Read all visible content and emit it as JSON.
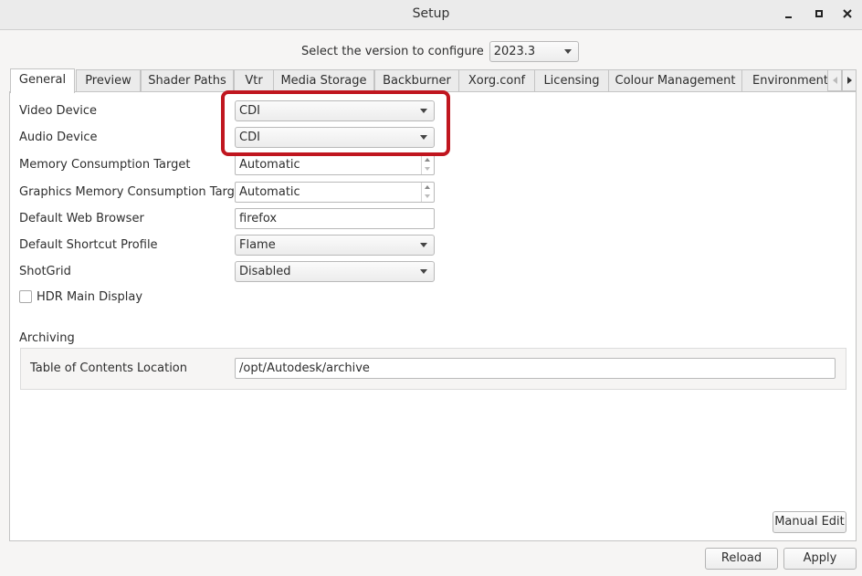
{
  "window": {
    "title": "Setup"
  },
  "version": {
    "label": "Select the version to configure",
    "value": "2023.3"
  },
  "tabs": [
    {
      "label": "General"
    },
    {
      "label": "Preview"
    },
    {
      "label": "Shader Paths"
    },
    {
      "label": "Vtr"
    },
    {
      "label": "Media Storage"
    },
    {
      "label": "Backburner"
    },
    {
      "label": "Xorg.conf"
    },
    {
      "label": "Licensing"
    },
    {
      "label": "Colour Management"
    },
    {
      "label": "Environment V"
    }
  ],
  "general": {
    "video_device": {
      "label": "Video Device",
      "value": "CDI"
    },
    "audio_device": {
      "label": "Audio Device",
      "value": "CDI"
    },
    "memory_target": {
      "label": "Memory Consumption Target",
      "value": "Automatic"
    },
    "gfx_memory_target": {
      "label": "Graphics Memory Consumption Target",
      "value": "Automatic"
    },
    "web_browser": {
      "label": "Default Web Browser",
      "value": "firefox"
    },
    "shortcut_profile": {
      "label": "Default Shortcut Profile",
      "value": "Flame"
    },
    "shotgrid": {
      "label": "ShotGrid",
      "value": "Disabled"
    },
    "hdr_main_display": {
      "label": "HDR Main Display",
      "checked": false
    },
    "archiving": {
      "title": "Archiving",
      "toc_location": {
        "label": "Table of Contents Location",
        "value": "/opt/Autodesk/archive"
      }
    }
  },
  "buttons": {
    "manual_edit": "Manual Edit",
    "reload": "Reload",
    "apply": "Apply"
  },
  "colors": {
    "highlight": "#c0161f"
  }
}
